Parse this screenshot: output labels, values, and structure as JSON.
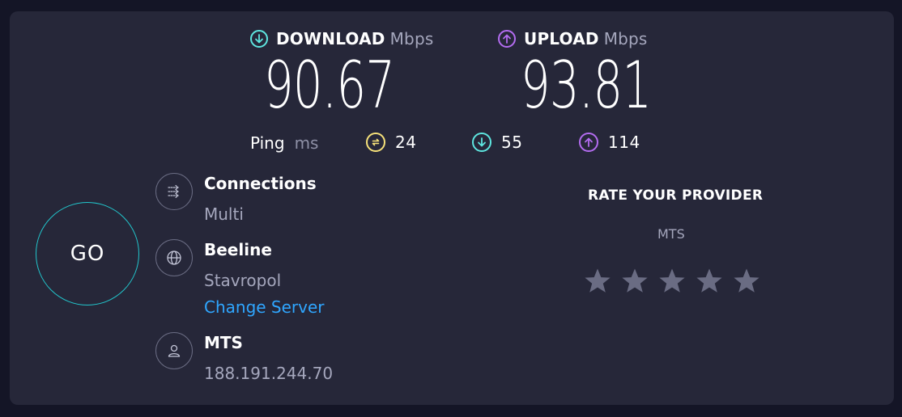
{
  "download": {
    "label": "DOWNLOAD",
    "unit": "Mbps",
    "value": "90.67",
    "icon": "download-arrow-icon",
    "color": "#5ee6e0"
  },
  "upload": {
    "label": "UPLOAD",
    "unit": "Mbps",
    "value": "93.81",
    "icon": "upload-arrow-icon",
    "color": "#b36cf0"
  },
  "ping": {
    "label": "Ping",
    "unit": "ms",
    "idle": {
      "value": "24",
      "icon": "idle-ping-icon",
      "color": "#f7e27a"
    },
    "download": {
      "value": "55",
      "icon": "download-ping-icon",
      "color": "#5ee6e0"
    },
    "upload": {
      "value": "114",
      "icon": "upload-ping-icon",
      "color": "#b36cf0"
    }
  },
  "go_button": {
    "label": "GO",
    "color": "#22c6cc"
  },
  "connections": {
    "title": "Connections",
    "value": "Multi",
    "icon": "connections-icon"
  },
  "server": {
    "title": "Beeline",
    "location": "Stavropol",
    "change_label": "Change Server",
    "icon": "globe-icon",
    "link_color": "#2fa6ff"
  },
  "provider": {
    "title": "MTS",
    "ip": "188.191.244.70",
    "icon": "user-icon"
  },
  "rate": {
    "title": "RATE YOUR PROVIDER",
    "provider": "MTS",
    "stars_total": 5,
    "stars_selected": 0
  }
}
